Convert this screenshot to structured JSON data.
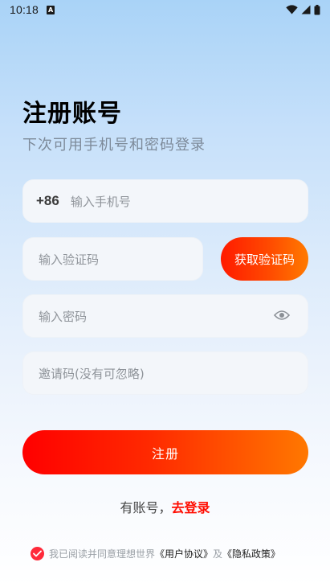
{
  "status_bar": {
    "time": "10:18",
    "notification_icon": "a-badge-icon",
    "icons": [
      "wifi-icon",
      "signal-icon",
      "battery-icon"
    ]
  },
  "header": {
    "title": "注册账号",
    "subtitle": "下次可用手机号和密码登录"
  },
  "form": {
    "country_code": "+86",
    "phone_placeholder": "输入手机号",
    "code_placeholder": "输入验证码",
    "get_code_label": "获取验证码",
    "password_placeholder": "输入密码",
    "password_toggle_icon": "eye-icon",
    "invite_placeholder": "邀请码(没有可忽略)",
    "register_label": "注册"
  },
  "login": {
    "prefix": "有账号，",
    "link": "去登录"
  },
  "agreement": {
    "checked": true,
    "text": "我已阅读并同意理想世界",
    "user_agreement": "《用户协议》",
    "and": "及",
    "privacy_policy": "《隐私政策》"
  },
  "colors": {
    "accent": "#ff1a00",
    "accent_end": "#ff7800",
    "link_red": "#ff0c00",
    "check_red": "#ff2a3a"
  }
}
